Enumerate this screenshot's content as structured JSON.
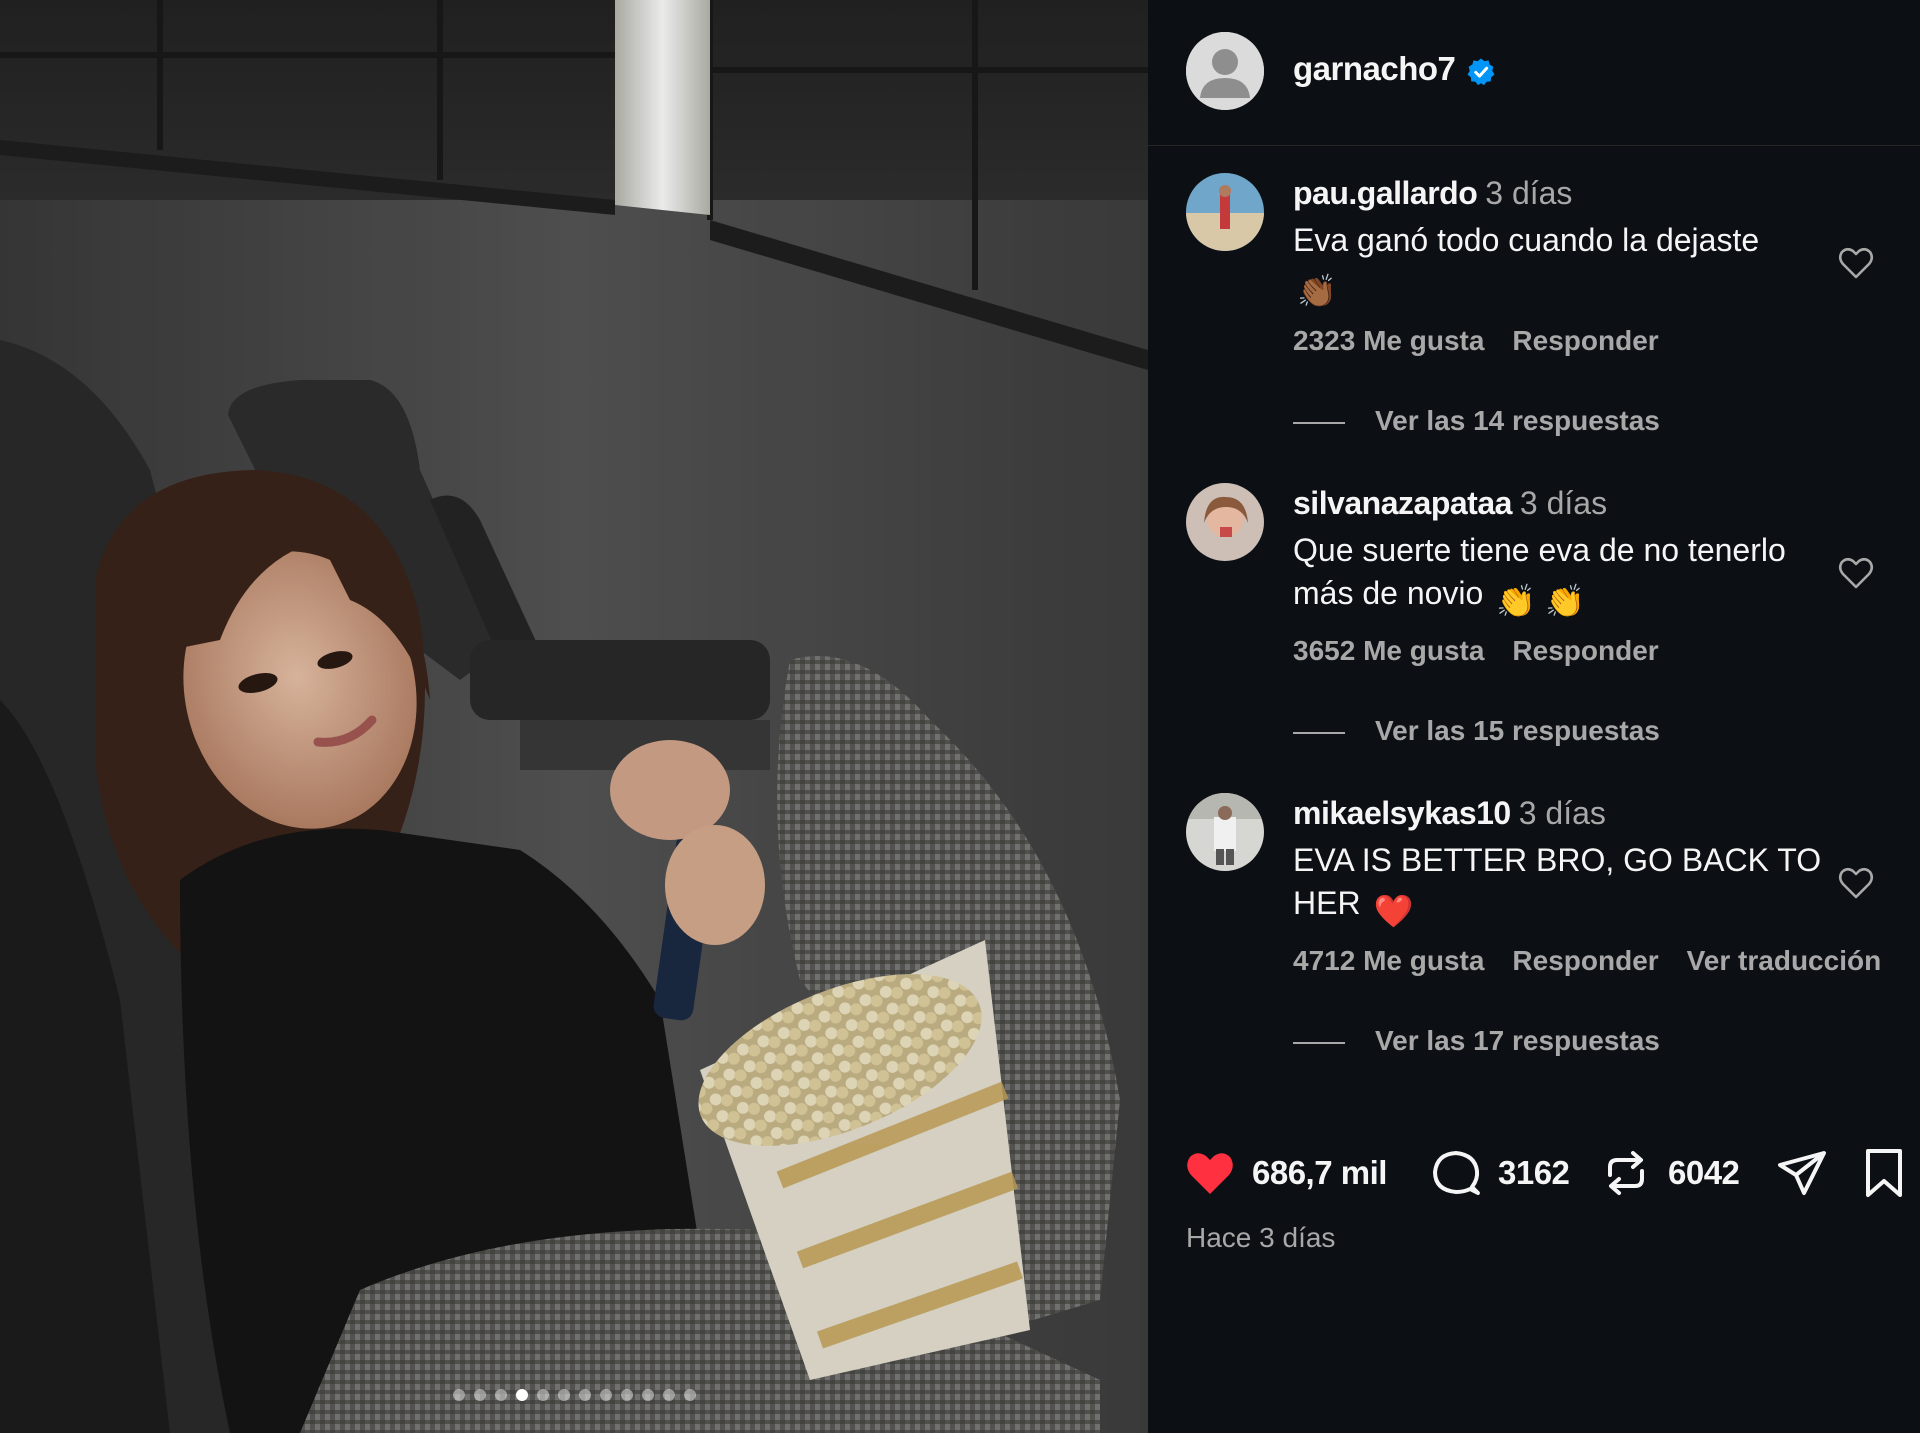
{
  "post": {
    "author": "garnacho7",
    "verified": true,
    "carousel": {
      "count": 12,
      "active_index": 3
    }
  },
  "comments": [
    {
      "username": "pau.gallardo",
      "time": "3 días",
      "text": "Eva ganó todo cuando la dejaste",
      "emoji": "👏🏾",
      "likes": "2323 Me gusta",
      "reply": "Responder",
      "view_replies": "Ver las 14 respuestas"
    },
    {
      "username": "silvanazapataa",
      "time": "3 días",
      "text": "Que suerte tiene eva de no tenerlo más de novio",
      "emoji": "👏 👏",
      "likes": "3652 Me gusta",
      "reply": "Responder",
      "view_replies": "Ver las 15 respuestas"
    },
    {
      "username": "mikaelsykas10",
      "time": "3 días",
      "text": "EVA IS BETTER BRO, GO BACK TO HER",
      "emoji": "❤️",
      "likes": "4712 Me gusta",
      "reply": "Responder",
      "translate": "Ver traducción",
      "view_replies": "Ver las 17 respuestas"
    }
  ],
  "actions": {
    "likes": "686,7 mil",
    "comments": "3162",
    "reposts": "6042"
  },
  "posted": "Hace 3 días",
  "colors": {
    "background": "#0c1014",
    "text_primary": "#f5f5f5",
    "text_secondary": "#a8a8a8",
    "like_red": "#ff3040",
    "verified_blue": "#0095f6"
  }
}
